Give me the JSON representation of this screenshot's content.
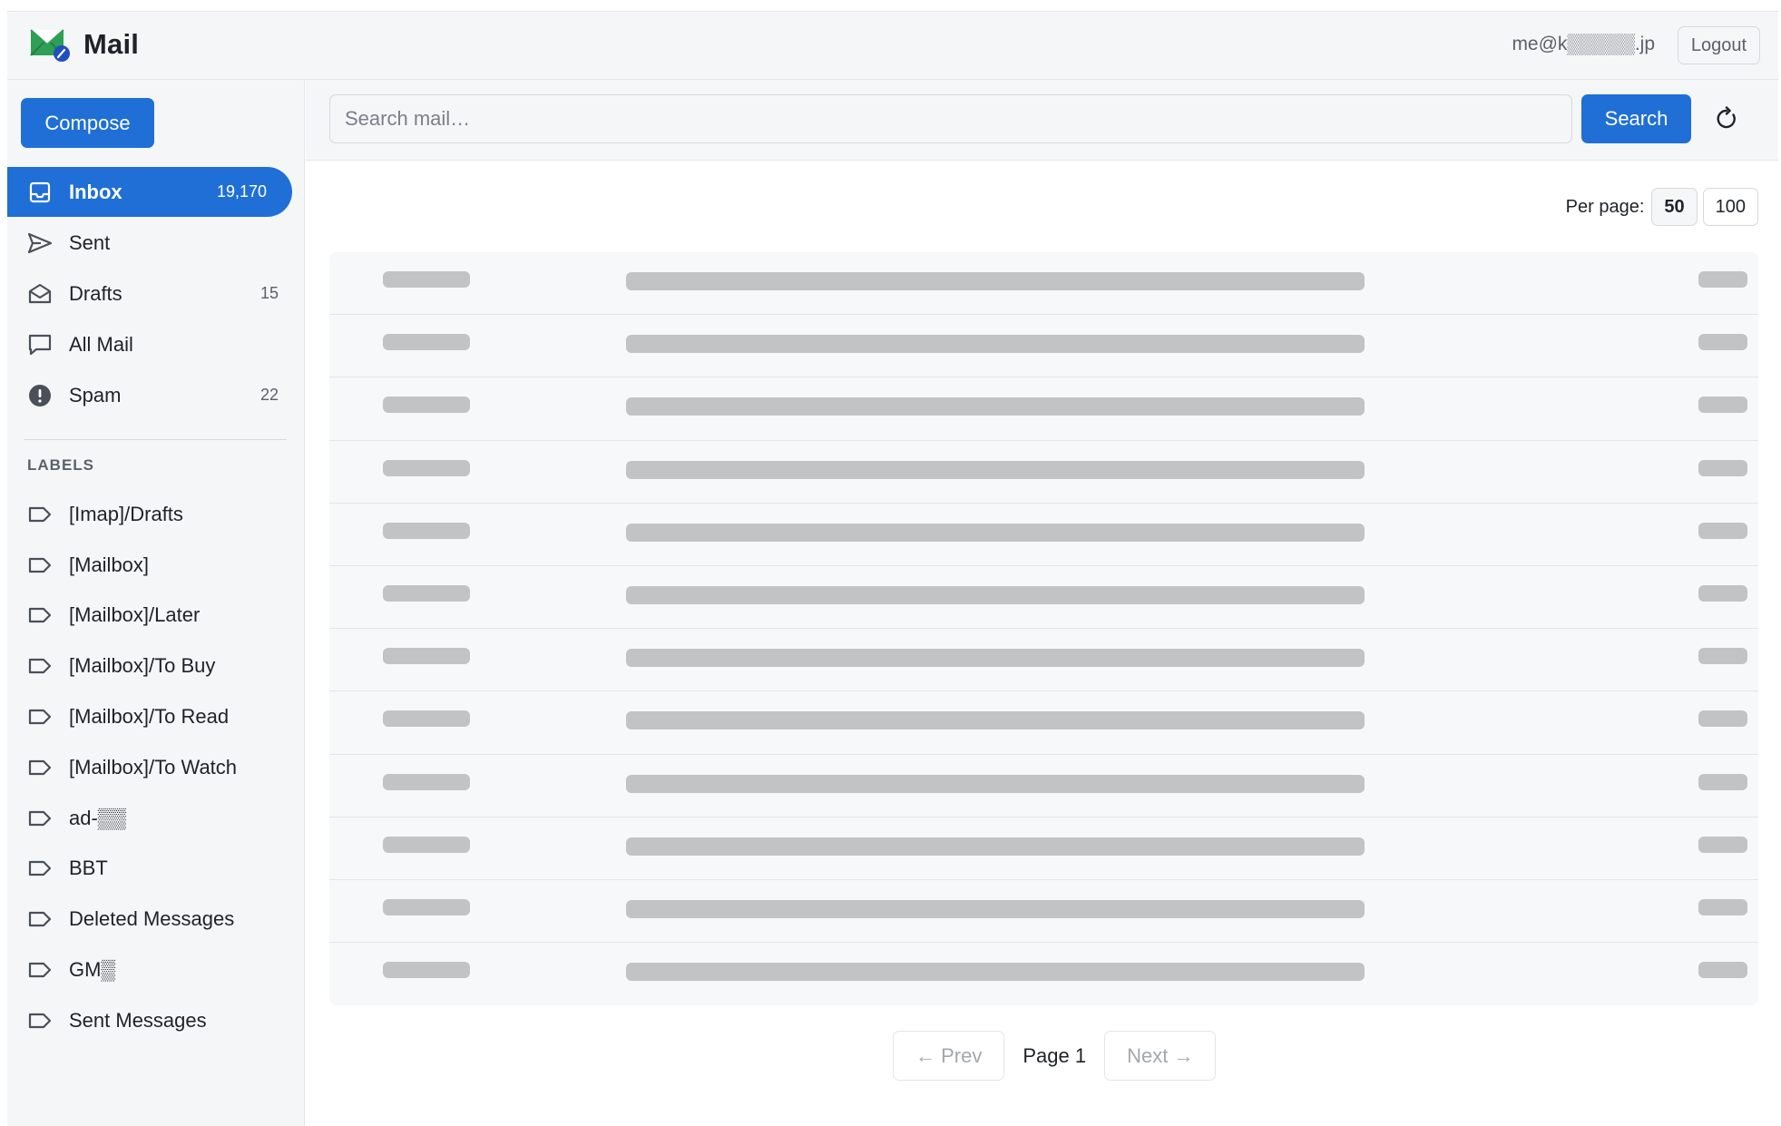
{
  "app": {
    "name": "Mail"
  },
  "header": {
    "user_email": "me@k▒▒▒▒▒.jp",
    "logout_label": "Logout"
  },
  "sidebar": {
    "compose_label": "Compose",
    "nav": [
      {
        "label": "Inbox",
        "count": "19,170",
        "icon": "inbox-icon",
        "active": true
      },
      {
        "label": "Sent",
        "count": "",
        "icon": "send-icon",
        "active": false
      },
      {
        "label": "Drafts",
        "count": "15",
        "icon": "envelope-open-icon",
        "active": false
      },
      {
        "label": "All Mail",
        "count": "",
        "icon": "chat-bubble-icon",
        "active": false
      },
      {
        "label": "Spam",
        "count": "22",
        "icon": "alert-icon",
        "active": false
      }
    ],
    "labels_header": "LABELS",
    "labels": [
      "[Imap]/Drafts",
      "[Mailbox]",
      "[Mailbox]/Later",
      "[Mailbox]/To Buy",
      "[Mailbox]/To Read",
      "[Mailbox]/To Watch",
      "ad-▒▒",
      "BBT",
      "Deleted Messages",
      "GM▒",
      "Sent Messages"
    ]
  },
  "search": {
    "placeholder": "Search mail…",
    "button_label": "Search"
  },
  "pagination": {
    "per_page_label": "Per page:",
    "per_page_options": [
      "50",
      "100"
    ],
    "per_page_selected": "50",
    "prev_label": "← Prev",
    "page_label": "Page 1",
    "next_label": "Next →"
  },
  "colors": {
    "accent": "#1f6fd6",
    "sidebar_bg": "#f5f6f8",
    "skeleton": "#c2c3c5"
  }
}
